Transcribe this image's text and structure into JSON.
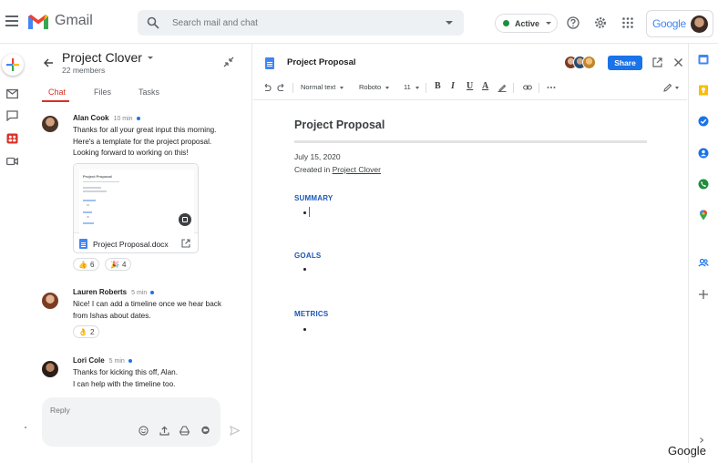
{
  "topbar": {
    "logo_text": "Gmail",
    "search_placeholder": "Search mail and chat",
    "status_label": "Active",
    "google_label": "Google"
  },
  "room": {
    "title": "Project Clover",
    "members": "22 members",
    "tabs": [
      {
        "label": "Chat",
        "active": true
      },
      {
        "label": "Files",
        "active": false
      },
      {
        "label": "Tasks",
        "active": false
      }
    ]
  },
  "messages": [
    {
      "name": "Alan Cook",
      "time": "10 min",
      "lines": [
        "Thanks for all your great input this morning.",
        "Here's a template for the project proposal.",
        "Looking forward to working on this!"
      ],
      "attachment": {
        "thumb_title": "Project Proposal",
        "name": "Project Proposal.docx"
      },
      "reactions": [
        {
          "emoji": "👍",
          "count": "6"
        },
        {
          "emoji": "🎉",
          "count": "4"
        }
      ]
    },
    {
      "name": "Lauren Roberts",
      "time": "5 min",
      "lines": [
        "Nice! I can add a timeline once we hear back",
        "from Ishas about dates."
      ],
      "reactions": [
        {
          "emoji": "👌",
          "count": "2"
        }
      ]
    },
    {
      "name": "Lori Cole",
      "time": "5 min",
      "lines": [
        "Thanks for kicking this off, Alan.",
        "I can help with the timeline too."
      ]
    }
  ],
  "reply": {
    "placeholder": "Reply"
  },
  "doc": {
    "header_title": "Project Proposal",
    "share_label": "Share",
    "toolbar": {
      "style": "Normal text",
      "font": "Roboto",
      "size": "11",
      "bold": "B",
      "italic": "I",
      "underline": "U",
      "text_color": "A"
    },
    "title": "Project Proposal",
    "date": "July 15, 2020",
    "created_prefix": "Created in",
    "created_link": "Project Clover",
    "sections": [
      "SUMMARY",
      "GOALS",
      "METRICS"
    ]
  },
  "watermark": "Google",
  "colors": {
    "accent": "#1a73e8",
    "chat_tab_active": "#d93025",
    "status_green": "#1e8e3e",
    "section_heading": "#1a57b5"
  }
}
